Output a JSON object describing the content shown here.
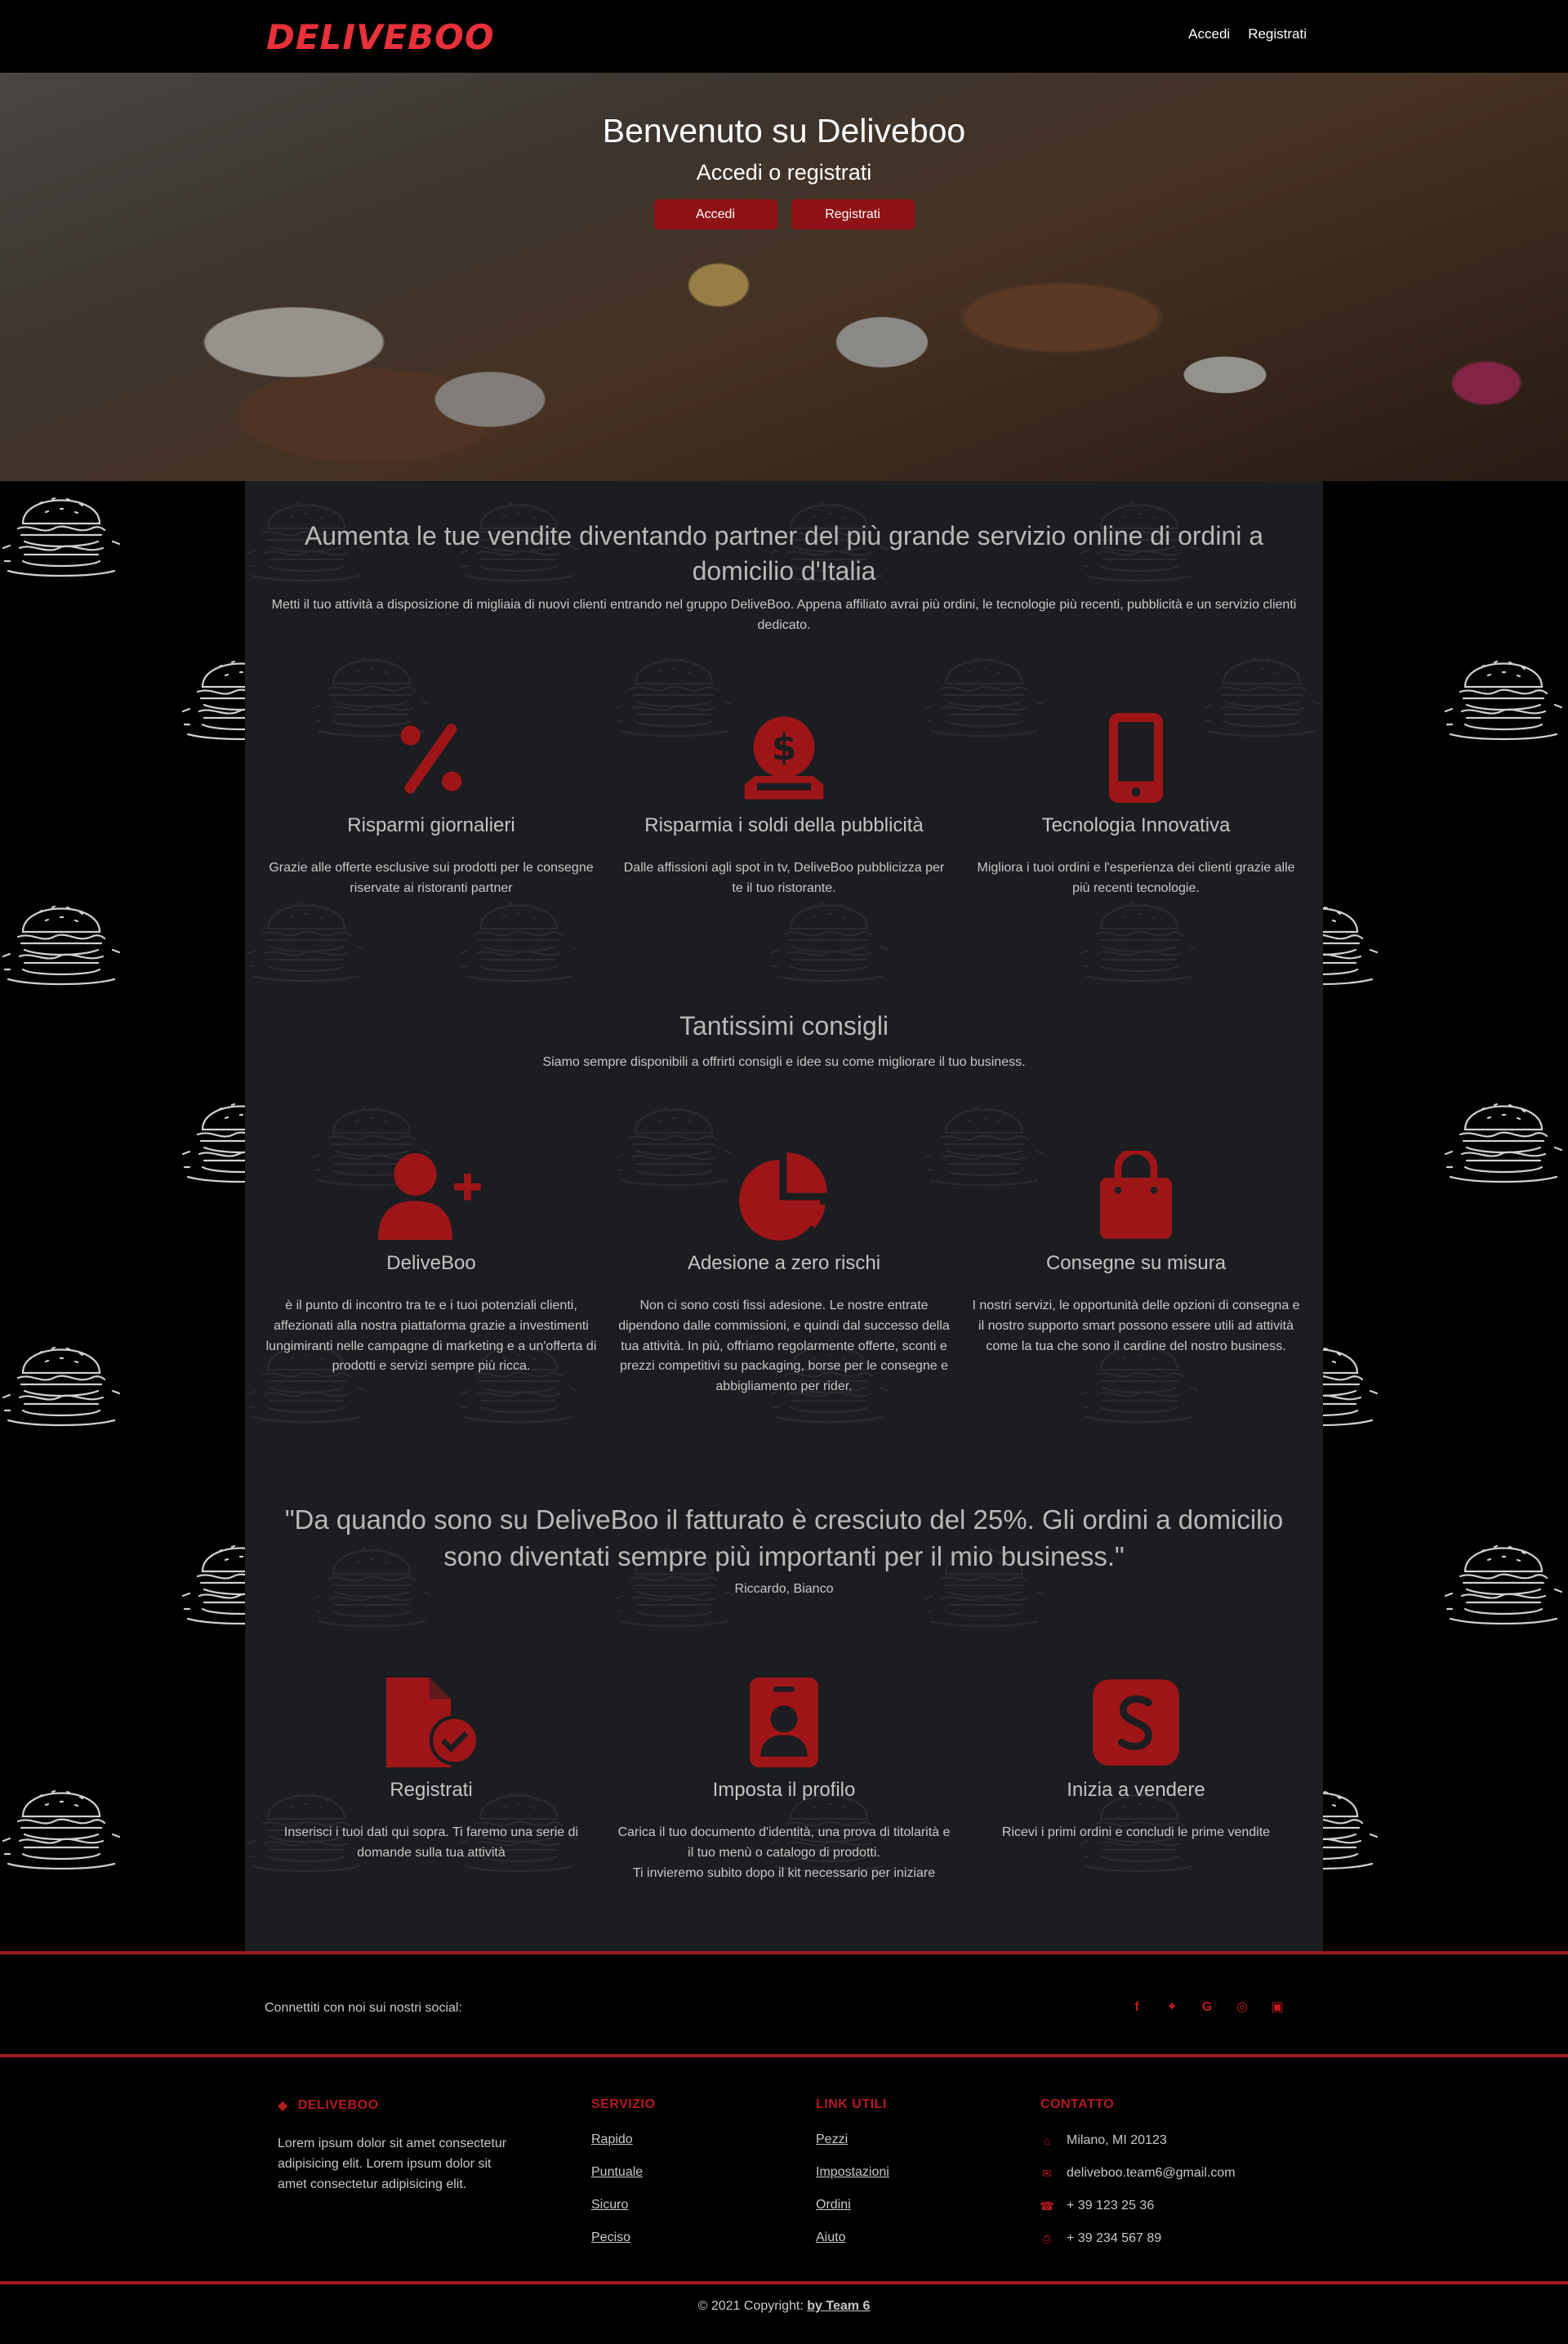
{
  "brand": {
    "logo_text": "DELIVEBOO"
  },
  "nav": {
    "login": "Accedi",
    "register": "Registrati"
  },
  "hero": {
    "title": "Benvenuto su Deliveboo",
    "subtitle": "Accedi o registrati",
    "login_button": "Accedi",
    "register_button": "Registrati"
  },
  "intro": {
    "title": "Aumenta le tue vendite diventando partner del più grande servizio online di ordini a domicilio d'Italia",
    "text": "Metti il tuo attività a disposizione di migliaia di nuovi clienti entrando nel gruppo DeliveBoo. Appena affiliato avrai più ordini, le tecnologie più recenti, pubblicità e un servizio clienti dedicato."
  },
  "features_1": [
    {
      "icon": "percent-icon",
      "title": "Risparmi giornalieri",
      "text": "Grazie alle offerte esclusive sui prodotti per le consegne riservate ai ristoranti partner"
    },
    {
      "icon": "dollar-coin-icon",
      "title": "Risparmia i soldi della pubblicità",
      "text": "Dalle affissioni agli spot in tv, DeliveBoo pubblicizza per te il tuo ristorante."
    },
    {
      "icon": "mobile-icon",
      "title": "Tecnologia Innovativa",
      "text": "Migliora i tuoi ordini e l'esperienza dei clienti grazie alle più recenti tecnologie."
    }
  ],
  "tips": {
    "title": "Tantissimi consigli",
    "text": "Siamo sempre disponibili a offrirti consigli e idee su come migliorare il tuo business."
  },
  "features_2": [
    {
      "icon": "user-plus-icon",
      "title": "DeliveBoo",
      "text": "è il punto di incontro tra te e i tuoi potenziali clienti, affezionati alla nostra piattaforma grazie a investimenti lungimiranti nelle campagne di marketing e a un'offerta di prodotti e servizi sempre più ricca."
    },
    {
      "icon": "pie-chart-icon",
      "title": "Adesione a zero rischi",
      "text": "Non ci sono costi fissi adesione. Le nostre entrate dipendono dalle commissioni, e quindi dal successo della tua attività. In più, offriamo regolarmente offerte, sconti e prezzi competitivi su packaging, borse per le consegne e abbigliamento per rider."
    },
    {
      "icon": "shopping-bag-icon",
      "title": "Consegne su misura",
      "text": "I nostri servizi, le opportunità delle opzioni di consegna e il nostro supporto smart possono essere utili ad attività come la tua che sono il cardine del nostro business."
    }
  ],
  "testimonial": {
    "quote": "\"Da quando sono su DeliveBoo il fatturato è cresciuto del 25%. Gli ordini a domicilio sono diventati sempre più importanti per il mio business.\"",
    "author": "Riccardo, Bianco"
  },
  "steps": [
    {
      "icon": "file-check-icon",
      "title": "Registrati",
      "text": "Inserisci i tuoi dati qui sopra. Ti faremo una serie di domande sulla tua attività"
    },
    {
      "icon": "id-badge-icon",
      "title": "Imposta il profilo",
      "text": "Carica il tuo documento d'identità, una prova di titolarità e il tuo menù o catalogo di prodotti.",
      "text2": "Ti invieremo subito dopo il kit necessario per iniziare"
    },
    {
      "icon": "stripe-icon",
      "title": "Inizia a vendere",
      "text": "Ricevi i primi ordini e concludi le prime vendite"
    }
  ],
  "social": {
    "text": "Connettiti con noi sui nostri social:",
    "icons": [
      "facebook-icon",
      "twitter-icon",
      "google-icon",
      "instagram-icon",
      "linkedin-icon"
    ]
  },
  "footer": {
    "about_title": "DELIVEBOO",
    "about_text": "Lorem ipsum dolor sit amet consectetur adipisicing elit. Lorem ipsum dolor sit amet consectetur adipisicing elit.",
    "service_title": "SERVIZIO",
    "service_links": [
      "Rapido",
      "Puntuale",
      "Sicuro",
      "Peciso"
    ],
    "links_title": "LINK UTILI",
    "useful_links": [
      "Pezzi",
      "Impostazioni",
      "Ordini",
      "Aiuto"
    ],
    "contact_title": "CONTATTO",
    "contacts": [
      {
        "icon": "home-icon",
        "text": "Milano, MI 20123"
      },
      {
        "icon": "envelope-icon",
        "text": "deliveboo.team6@gmail.com"
      },
      {
        "icon": "phone-icon",
        "text": "+ 39 123 25 36"
      },
      {
        "icon": "print-icon",
        "text": "+ 39 234 567 89"
      }
    ]
  },
  "copyright": {
    "text": "© 2021 Copyright:",
    "link": "by Team 6"
  },
  "colors": {
    "accent": "#a01a1d",
    "icon_red": "#9e1518",
    "panel": "#1b1d20"
  }
}
